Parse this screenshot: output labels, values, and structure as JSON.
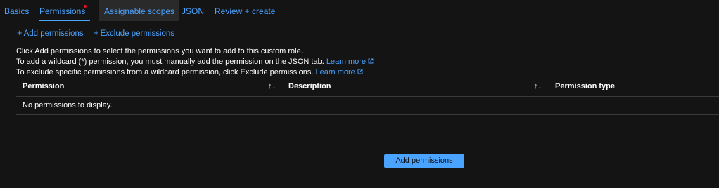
{
  "tabs": [
    {
      "label": "Basics"
    },
    {
      "label": "Permissions"
    },
    {
      "label": "Assignable scopes"
    },
    {
      "label": "JSON"
    },
    {
      "label": "Review + create"
    }
  ],
  "toolbar": {
    "add_label": "Add permissions",
    "exclude_label": "Exclude permissions"
  },
  "info": {
    "line1": "Click Add permissions to select the permissions you want to add to this custom role.",
    "line2": "To add a wildcard (*) permission, you must manually add the permission on the JSON tab.",
    "line3": "To exclude specific permissions from a wildcard permission, click Exclude permissions.",
    "learn_more": "Learn more"
  },
  "table": {
    "columns": [
      "Permission",
      "Description",
      "Permission type"
    ],
    "sort_glyph": "↑↓",
    "empty_text": "No permissions to display."
  },
  "primary_button": {
    "label": "Add permissions"
  },
  "colors": {
    "background": "#141414",
    "accent": "#4aa3ff",
    "required_dot": "#e81123",
    "divider": "#3a3a3a"
  }
}
